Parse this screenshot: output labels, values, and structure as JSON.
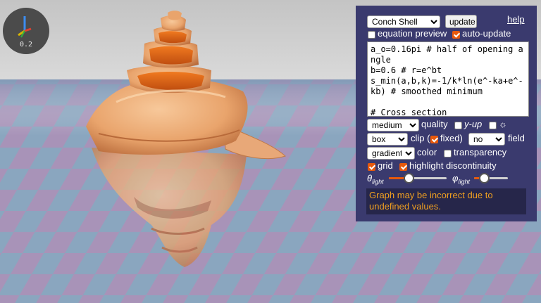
{
  "axes_widget": {
    "scale": "0.2"
  },
  "panel": {
    "preset": {
      "selected": "Conch Shell"
    },
    "update_label": "update",
    "help_label": "help",
    "equation_preview_label": "equation preview",
    "auto_update_label": "auto-update",
    "equation_text": "a_o=0.16pi # half of opening angle\nb=0.6 # r=e^bt\ns_min(a,b,k)=-1/k*ln(e^-ka+e^-kb) # smoothed minimum\n\n# Cross section",
    "quality": {
      "selected": "medium",
      "label": "quality"
    },
    "y_up_label": "y-up",
    "sun_symbol": "☼",
    "clip": {
      "selected": "box",
      "label": "clip (",
      "fixed_label": "fixed)"
    },
    "field": {
      "selected": "no",
      "label": "field"
    },
    "color": {
      "selected": "gradient",
      "label": "color"
    },
    "transparency_label": "transparency",
    "grid_label": "grid",
    "highlight_label": "highlight discontinuity",
    "theta_light": {
      "symbol": "θ",
      "sub": "light",
      "value": 0.35
    },
    "phi_light": {
      "symbol": "φ",
      "sub": "light",
      "value": 0.3
    },
    "warning": "Graph may be incorrect due to undefined values.",
    "checkboxes": {
      "equation_preview": false,
      "auto_update": true,
      "y_up": false,
      "sun": false,
      "clip_fixed": true,
      "transparency": false,
      "grid": true,
      "highlight": true
    }
  },
  "colors": {
    "panel_bg": "#3a3a6e",
    "accent": "#e8590c",
    "warning_text": "#f0a020",
    "shell": "#e8a070"
  }
}
